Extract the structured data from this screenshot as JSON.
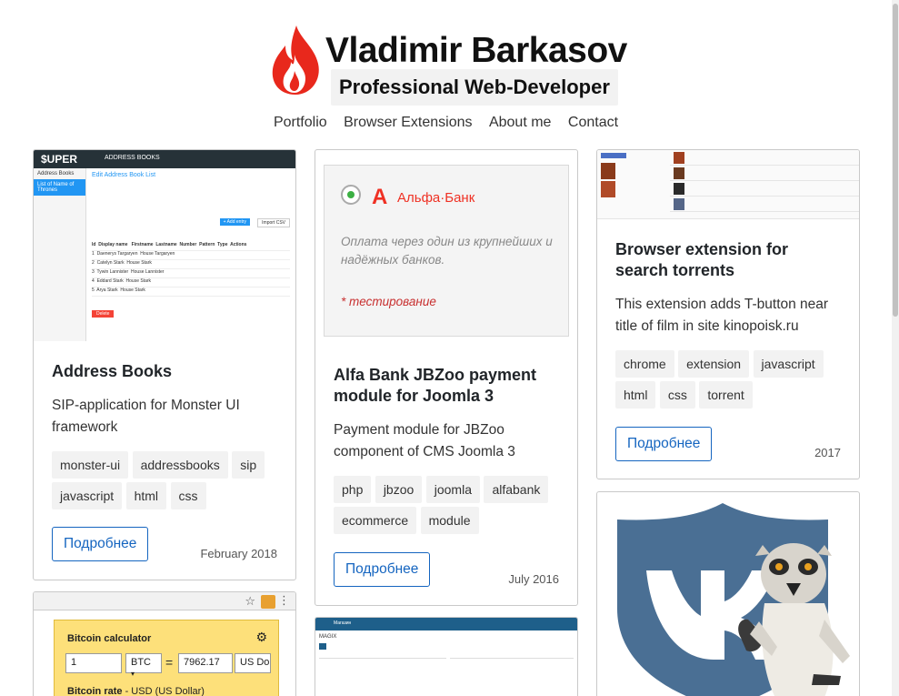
{
  "header": {
    "name": "Vladimir Barkasov",
    "tagline": "Professional Web-Developer",
    "brand_color": "#e8281c"
  },
  "nav": [
    {
      "label": "Portfolio"
    },
    {
      "label": "Browser Extensions"
    },
    {
      "label": "About me"
    },
    {
      "label": "Contact"
    }
  ],
  "cards": {
    "address_books": {
      "title": "Address Books",
      "description": "SIP-application for Monster UI framework",
      "tags": [
        "monster-ui",
        "addressbooks",
        "sip",
        "javascript",
        "html",
        "css"
      ],
      "button": "Подробнее",
      "date": "February 2018",
      "shot": {
        "logo": "$UPER",
        "app_title": "ADDRESS BOOKS",
        "sidebar_title": "Address Books",
        "sidebar_active": "List of Name of Thrones",
        "heading": "Edit Address Book List",
        "add_entry": "+ Add entry",
        "import": "Import CSV",
        "delete": "Delete",
        "columns": [
          "Id",
          "Display name",
          "Firstname",
          "Lastname",
          "Number",
          "Pattern",
          "Type",
          "Actions"
        ],
        "rows": [
          [
            "1",
            "Daenerys Targaryen",
            "Aegon",
            "Targaryen",
            "444001",
            "",
            "House Targaryen"
          ],
          [
            "2",
            "Catelyn Stark",
            "Catelyn",
            "Stark",
            "222222",
            "",
            "House Stark"
          ],
          [
            "3",
            "Tywin Lannister",
            "Tywin",
            "Lannister",
            "333001",
            "",
            "House Lannister"
          ],
          [
            "4",
            "Eddard Stark",
            "Ned",
            "Stark",
            "222223",
            "",
            "House Stark"
          ],
          [
            "5",
            "Arya Stark",
            "Arya",
            "Stark",
            "222224",
            "",
            "House Stark"
          ]
        ]
      }
    },
    "alfa_bank": {
      "title": "Alfa Bank JBZoo payment module for Joomla 3",
      "description": "Payment module for JBZoo component of CMS Joomla 3",
      "tags": [
        "php",
        "jbzoo",
        "joomla",
        "alfabank",
        "ecommerce",
        "module"
      ],
      "button": "Подробнее",
      "date": "July 2016",
      "shot": {
        "logo_letter": "А",
        "bank_name": "Альфа·Банк",
        "text": "Оплата через один из крупнейших и надёжных банков.",
        "note": "* тестирование"
      }
    },
    "torrents": {
      "title": "Browser extension for search torrents",
      "description": "This extension adds T-button near title of film in site kinopoisk.ru",
      "tags": [
        "chrome",
        "extension",
        "javascript",
        "html",
        "css",
        "torrent"
      ],
      "button": "Подробнее",
      "date": "2017"
    },
    "bitcoin": {
      "title": "Bitcoin calculator",
      "amount": "1",
      "currency_from": "BTC",
      "equals": "=",
      "result": "7962.17",
      "currency_to": "US Dollar",
      "rate_label": "Bitcoin rate",
      "rate_unit": "USD (US Dollar)"
    },
    "magix": {
      "title": "Магазин",
      "subtitle": "MAGIX"
    },
    "vk": {
      "shield_color": "#4a6f94"
    }
  }
}
